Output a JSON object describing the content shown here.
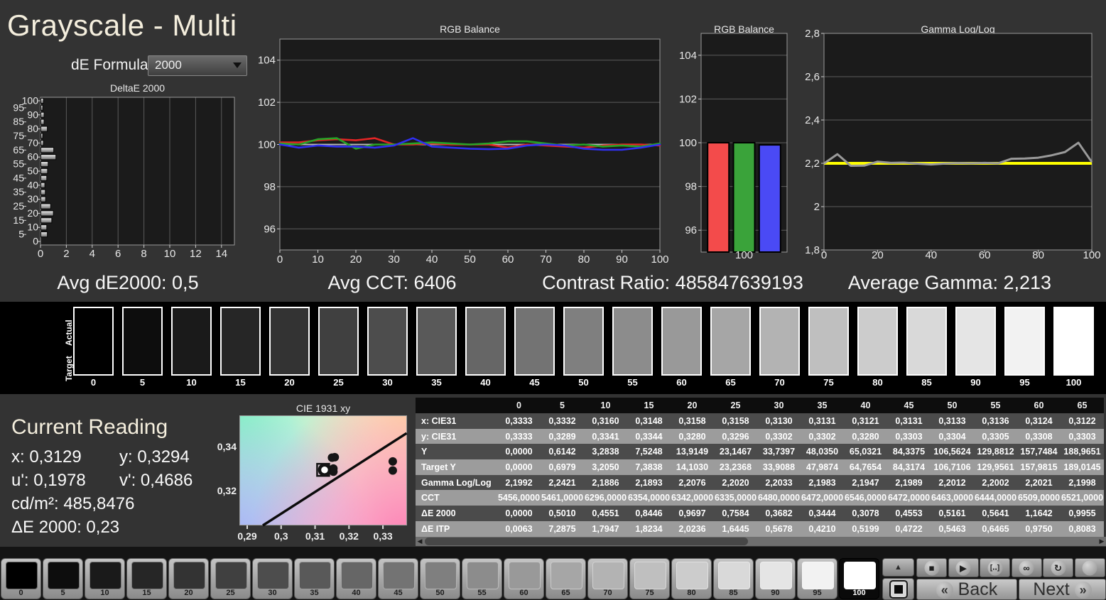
{
  "header": {
    "title": "Grayscale - Multi",
    "de_formula_label": "dE Formula:",
    "de_formula_value": "2000"
  },
  "stats": {
    "avg_de": "Avg dE2000: 0,5",
    "avg_cct": "Avg CCT: 6406",
    "contrast": "Contrast Ratio: 485847639193",
    "avg_gamma": "Average Gamma: 2,213"
  },
  "swatch_strip": {
    "actual_label": "Actual",
    "target_label": "Target",
    "levels": [
      0,
      5,
      10,
      15,
      20,
      25,
      30,
      35,
      40,
      45,
      50,
      55,
      60,
      65,
      70,
      75,
      80,
      85,
      90,
      95,
      100
    ]
  },
  "current_reading": {
    "heading": "Current Reading",
    "x": "x: 0,3129",
    "y": "y: 0,3294",
    "u": "u': 0,1978",
    "v": "v': 0,4686",
    "cd": "cd/m²: 485,8476",
    "de": "ΔE 2000: 0,23"
  },
  "table": {
    "col_headers": [
      "0",
      "5",
      "10",
      "15",
      "20",
      "25",
      "30",
      "35",
      "40",
      "45",
      "50",
      "55",
      "60",
      "65"
    ],
    "rows": [
      {
        "label": "x: CIE31",
        "values": [
          "0,3333",
          "0,3332",
          "0,3160",
          "0,3148",
          "0,3158",
          "0,3158",
          "0,3130",
          "0,3131",
          "0,3121",
          "0,3131",
          "0,3133",
          "0,3136",
          "0,3124",
          "0,3122"
        ]
      },
      {
        "label": "y: CIE31",
        "values": [
          "0,3333",
          "0,3289",
          "0,3341",
          "0,3344",
          "0,3280",
          "0,3296",
          "0,3302",
          "0,3302",
          "0,3280",
          "0,3303",
          "0,3304",
          "0,3305",
          "0,3308",
          "0,3303"
        ]
      },
      {
        "label": "Y",
        "values": [
          "0,0000",
          "0,6142",
          "3,2838",
          "7,5248",
          "13,9149",
          "23,1467",
          "33,7397",
          "48,0350",
          "65,0321",
          "84,3375",
          "106,5624",
          "129,8812",
          "157,7484",
          "188,9651"
        ]
      },
      {
        "label": "Target Y",
        "values": [
          "0,0000",
          "0,6979",
          "3,2050",
          "7,3838",
          "14,1030",
          "23,2368",
          "33,9088",
          "47,9874",
          "64,7654",
          "84,3174",
          "106,7106",
          "129,9561",
          "157,9815",
          "189,0145"
        ]
      },
      {
        "label": "Gamma Log/Log",
        "values": [
          "2,1992",
          "2,2421",
          "2,1886",
          "2,1893",
          "2,2076",
          "2,2020",
          "2,2033",
          "2,1983",
          "2,1947",
          "2,1989",
          "2,2012",
          "2,2002",
          "2,2021",
          "2,1998"
        ]
      },
      {
        "label": "CCT",
        "values": [
          "5456,0000",
          "5461,0000",
          "6296,0000",
          "6354,0000",
          "6342,0000",
          "6335,0000",
          "6480,0000",
          "6472,0000",
          "6546,0000",
          "6472,0000",
          "6463,0000",
          "6444,0000",
          "6509,0000",
          "6521,0000"
        ]
      },
      {
        "label": "ΔE 2000",
        "values": [
          "0,0000",
          "0,5010",
          "0,4551",
          "0,8446",
          "0,9697",
          "0,7584",
          "0,3682",
          "0,3444",
          "0,3078",
          "0,4553",
          "0,5161",
          "0,5641",
          "1,1642",
          "0,9955"
        ]
      },
      {
        "label": "ΔE ITP",
        "values": [
          "0,0063",
          "7,2875",
          "1,7947",
          "1,8234",
          "2,0236",
          "1,6445",
          "0,5678",
          "0,4210",
          "0,5199",
          "0,4722",
          "0,5463",
          "0,6465",
          "0,9750",
          "0,8083"
        ]
      }
    ]
  },
  "bottom_bar": {
    "levels": [
      0,
      5,
      10,
      15,
      20,
      25,
      30,
      35,
      40,
      45,
      50,
      55,
      60,
      65,
      70,
      75,
      80,
      85,
      90,
      95,
      100
    ],
    "selected_level": 100,
    "controls": [
      {
        "name": "stop",
        "glyph": "■"
      },
      {
        "name": "play",
        "glyph": "▶"
      },
      {
        "name": "series",
        "glyph": "[‥]"
      },
      {
        "name": "continuous",
        "glyph": "∞"
      },
      {
        "name": "loop",
        "glyph": "↻"
      },
      {
        "name": "blank",
        "glyph": ""
      }
    ],
    "back": "Back",
    "next": "Next",
    "back_chevron": "«",
    "next_chevron": "»",
    "scroll_up_glyph": "▲"
  },
  "chart_data": [
    {
      "id": "deltae",
      "type": "bar",
      "orientation": "horizontal",
      "title": "DeltaE 2000",
      "categories": [
        0,
        5,
        10,
        15,
        20,
        25,
        30,
        35,
        40,
        45,
        50,
        55,
        60,
        65,
        70,
        75,
        80,
        85,
        90,
        95,
        100
      ],
      "values": [
        0.0,
        0.501,
        0.4551,
        0.8446,
        0.9697,
        0.7584,
        0.3682,
        0.3444,
        0.3078,
        0.4553,
        0.5161,
        0.5641,
        1.1642,
        0.9955,
        0.2,
        0.15,
        0.5,
        0.25,
        0.25,
        0.15,
        0.2
      ],
      "xlim": [
        0,
        15
      ],
      "xticks": [
        0,
        2,
        4,
        6,
        8,
        10,
        12,
        14
      ],
      "grid": true
    },
    {
      "id": "rgb-line",
      "type": "line",
      "title": "RGB Balance",
      "x": [
        0,
        5,
        10,
        15,
        20,
        25,
        30,
        35,
        40,
        45,
        50,
        55,
        60,
        65,
        70,
        75,
        80,
        85,
        90,
        95,
        100
      ],
      "ylim": [
        95,
        105
      ],
      "yticks": [
        96,
        98,
        100,
        102,
        104
      ],
      "xticks": [
        0,
        10,
        20,
        30,
        40,
        50,
        60,
        70,
        80,
        90,
        100
      ],
      "ref_line": 100,
      "grid": true,
      "series": [
        {
          "name": "red",
          "color": "#e42525",
          "values": [
            100.1,
            100.1,
            100.2,
            100.25,
            100.2,
            100.3,
            100.0,
            100.0,
            100.05,
            100.0,
            100.0,
            100.0,
            99.85,
            100.0,
            99.95,
            99.9,
            99.85,
            99.95,
            100.0,
            100.0,
            99.95
          ]
        },
        {
          "name": "green",
          "color": "#27a327",
          "values": [
            100.05,
            100.0,
            100.25,
            100.3,
            99.8,
            100.0,
            100.0,
            100.05,
            100.1,
            100.05,
            100.0,
            100.05,
            100.15,
            100.15,
            100.05,
            99.95,
            100.0,
            99.9,
            99.95,
            99.9,
            100.05
          ]
        },
        {
          "name": "blue",
          "color": "#2f2ff0",
          "values": [
            100.0,
            99.85,
            99.95,
            99.9,
            99.9,
            99.85,
            99.95,
            100.3,
            99.9,
            99.85,
            99.8,
            99.78,
            99.8,
            99.95,
            100.0,
            99.95,
            99.8,
            99.75,
            99.75,
            99.85,
            100.0
          ]
        }
      ]
    },
    {
      "id": "rgb-bar",
      "type": "bar",
      "title": "RGB Balance",
      "categories": [
        "100"
      ],
      "ylim": [
        95,
        105
      ],
      "yticks": [
        96,
        98,
        100,
        102,
        104
      ],
      "series": [
        {
          "name": "red",
          "color": "#f34b4b",
          "value": 100.0
        },
        {
          "name": "green",
          "color": "#3aa33a",
          "value": 100.0
        },
        {
          "name": "blue",
          "color": "#4a4af5",
          "value": 99.9
        }
      ]
    },
    {
      "id": "gamma",
      "type": "line",
      "title": "Gamma Log/Log",
      "x": [
        0,
        5,
        10,
        15,
        20,
        25,
        30,
        35,
        40,
        45,
        50,
        55,
        60,
        65,
        70,
        75,
        80,
        85,
        90,
        95,
        100
      ],
      "values": [
        2.1992,
        2.2421,
        2.1886,
        2.1893,
        2.2076,
        2.202,
        2.2033,
        2.1983,
        2.1947,
        2.1989,
        2.2012,
        2.2002,
        2.2021,
        2.1998,
        2.221,
        2.222,
        2.226,
        2.237,
        2.252,
        2.295,
        2.206
      ],
      "color": "#9a9a9a",
      "ref_line": 2.2,
      "ref_color": "#ffff00",
      "ylim": [
        1.8,
        2.8
      ],
      "yticks": [
        {
          "v": 2.8,
          "label": "2,8"
        },
        {
          "v": 2.6,
          "label": "2,6"
        },
        {
          "v": 2.4,
          "label": "2,4"
        },
        {
          "v": 2.2,
          "label": "2,2"
        },
        {
          "v": 2.0,
          "label": "2"
        },
        {
          "v": 1.8,
          "label": "1,8"
        }
      ],
      "xticks": [
        0,
        20,
        40,
        60,
        80,
        100
      ],
      "grid": true
    },
    {
      "id": "cie",
      "type": "scatter",
      "title": "CIE 1931 xy",
      "xlim": [
        0.2877,
        0.3371
      ],
      "ylim": [
        0.3045,
        0.354
      ],
      "xticks": [
        {
          "v": 0.29,
          "label": "0,29"
        },
        {
          "v": 0.3,
          "label": "0,3"
        },
        {
          "v": 0.31,
          "label": "0,31"
        },
        {
          "v": 0.32,
          "label": "0,32"
        },
        {
          "v": 0.33,
          "label": "0,33"
        }
      ],
      "yticks": [
        {
          "v": 0.34,
          "label": "0,34"
        },
        {
          "v": 0.32,
          "label": "0,32"
        }
      ],
      "locus_line": [
        [
          0.2946,
          0.3045
        ],
        [
          0.337,
          0.346
        ]
      ],
      "points": [
        [
          0.315,
          0.335
        ],
        [
          0.3158,
          0.3352
        ],
        [
          0.3154,
          0.3301
        ],
        [
          0.3154,
          0.3287
        ],
        [
          0.3329,
          0.3333
        ],
        [
          0.3329,
          0.3292
        ]
      ],
      "target_point": [
        0.3128,
        0.3295
      ]
    }
  ]
}
